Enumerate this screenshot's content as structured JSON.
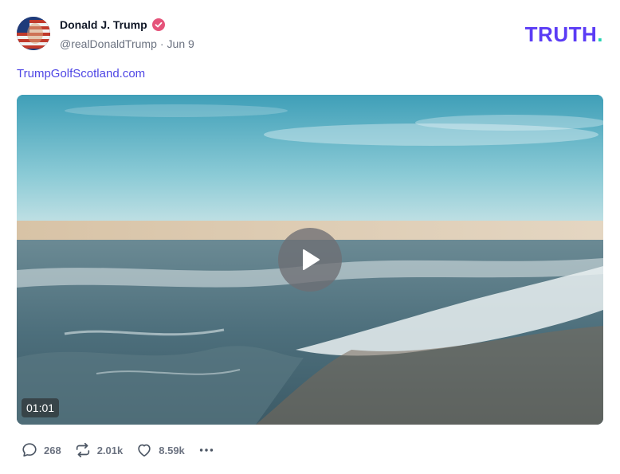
{
  "post": {
    "author_name": "Donald J. Trump",
    "handle": "@realDonaldTrump",
    "date": "Jun 9",
    "link_text": "TrumpGolfScotland.com",
    "verified": true
  },
  "brand": {
    "word": "TRUTH",
    "period": ".",
    "color": "#5b3cf5",
    "accent": "#23d3b2"
  },
  "video": {
    "duration": "01:01",
    "play_icon": "play-icon"
  },
  "actions": {
    "replies": "268",
    "reposts": "2.01k",
    "likes": "8.59k",
    "reply_icon": "comment-icon",
    "repost_icon": "repost-icon",
    "like_icon": "heart-icon",
    "more_icon": "more-icon"
  }
}
